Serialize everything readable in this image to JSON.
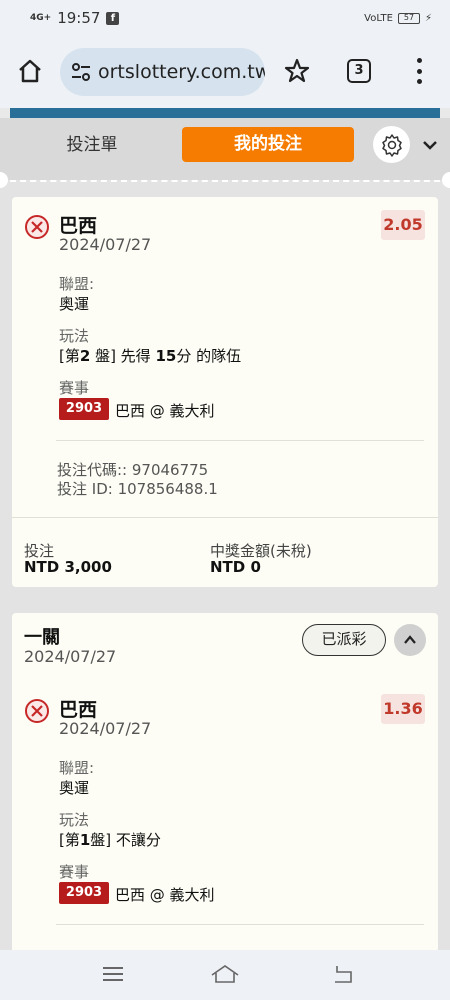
{
  "status_bar": {
    "network": "4G+",
    "time": "19:57",
    "app_icon": "facebook-icon",
    "volte": "VoLTE",
    "battery": "57"
  },
  "browser": {
    "url": "ortslottery.com.tw",
    "tab_count": "3"
  },
  "slip": {
    "tab_betslip": "投注單",
    "tab_mybets": "我的投注"
  },
  "bet1": {
    "team": "巴西",
    "date": "2024/07/27",
    "odds": "2.05",
    "league_label": "聯盟:",
    "league": "奧運",
    "market_label": "玩法",
    "market_pre": "[第",
    "market_num": "2",
    "market_mid": " 盤] 先得 ",
    "market_num2": "15",
    "market_post": "分 的隊伍",
    "event_label": "賽事",
    "event_code": "2903",
    "event_name": "巴西 @ 義大利",
    "bet_code": "投注代碼:: 97046775",
    "bet_id": "投注 ID: 107856488.1",
    "stake_label": "投注",
    "stake": "NTD 3,000",
    "payout_label": "中獎金額(未稅)",
    "payout": "NTD 0"
  },
  "bet2": {
    "title": "一關",
    "date": "2024/07/27",
    "status": "已派彩",
    "team": "巴西",
    "leg_date": "2024/07/27",
    "odds": "1.36",
    "league_label": "聯盟:",
    "league": "奧運",
    "market_label": "玩法",
    "market_pre": "[第",
    "market_num": "1",
    "market_post": "盤] 不讓分",
    "event_label": "賽事",
    "event_code": "2903",
    "event_name": "巴西 @ 義大利"
  }
}
